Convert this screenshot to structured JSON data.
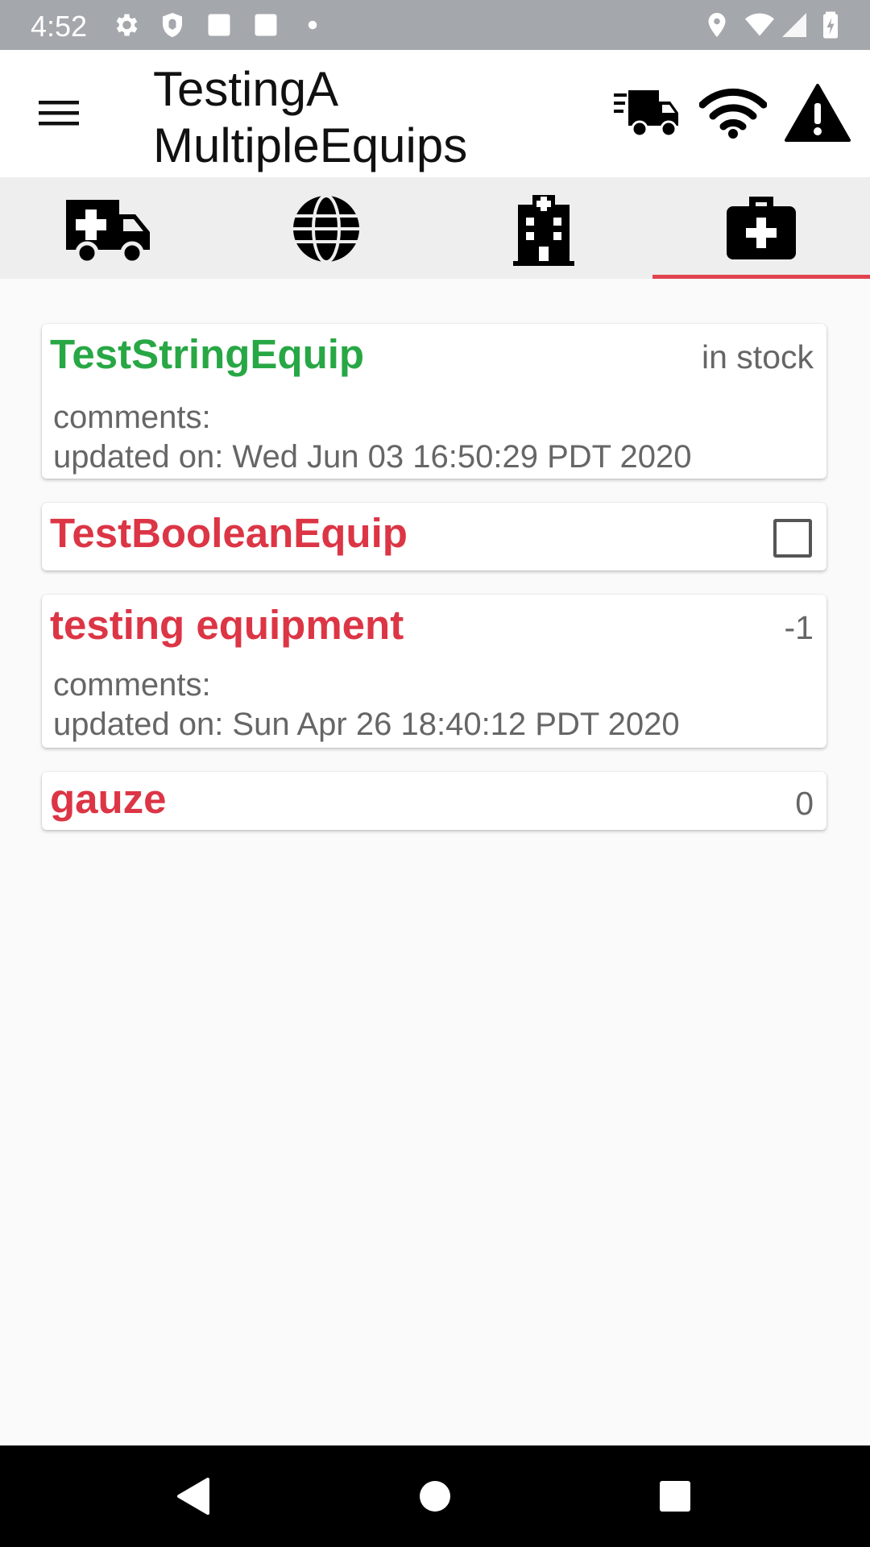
{
  "status_bar": {
    "time": "4:52",
    "icons": [
      "settings-icon",
      "shield-icon",
      "square-notification-icon",
      "square-notification-icon",
      "dot-icon",
      "location-icon",
      "wifi-icon",
      "signal-icon",
      "battery-icon"
    ]
  },
  "app_bar": {
    "title_line1": "TestingA",
    "title_line2": "MultipleEquips",
    "icons": [
      "menu-icon",
      "truck-icon",
      "wifi-icon",
      "warning-icon"
    ]
  },
  "tabs": [
    {
      "icon": "ambulance-icon",
      "active": false
    },
    {
      "icon": "globe-icon",
      "active": false
    },
    {
      "icon": "hospital-icon",
      "active": false
    },
    {
      "icon": "medkit-icon",
      "active": true
    }
  ],
  "accent_color": "#e0434f",
  "equipment": [
    {
      "name": "TestStringEquip",
      "status_color": "#28a745",
      "value": "in stock",
      "comments_label": "comments:",
      "updated": "updated on: Wed Jun 03 16:50:29 PDT 2020"
    },
    {
      "name": "TestBooleanEquip",
      "status_color": "#dc3545",
      "checked": false
    },
    {
      "name": "testing equipment",
      "status_color": "#dc3545",
      "value": "-1",
      "comments_label": "comments:",
      "updated": "updated on: Sun Apr 26 18:40:12 PDT 2020"
    },
    {
      "name": "gauze",
      "status_color": "#dc3545",
      "value": "0"
    }
  ],
  "nav_bar": {
    "icons": [
      "back-icon",
      "home-icon",
      "recents-icon"
    ]
  }
}
